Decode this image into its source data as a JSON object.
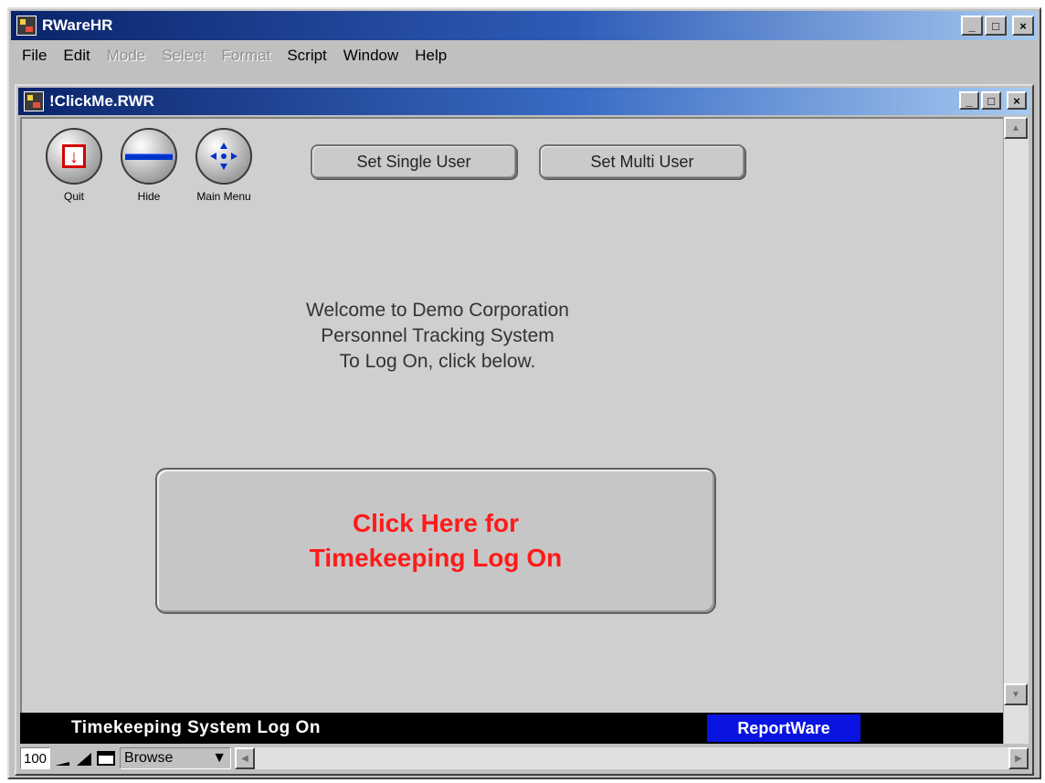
{
  "app": {
    "title": "RWareHR",
    "window_buttons": {
      "minimize": "_",
      "maximize": "□",
      "close": "×"
    }
  },
  "menubar": {
    "items": [
      {
        "label": "File",
        "enabled": true
      },
      {
        "label": "Edit",
        "enabled": true
      },
      {
        "label": "Mode",
        "enabled": false
      },
      {
        "label": "Select",
        "enabled": false
      },
      {
        "label": "Format",
        "enabled": false
      },
      {
        "label": "Script",
        "enabled": true
      },
      {
        "label": "Window",
        "enabled": true
      },
      {
        "label": "Help",
        "enabled": true
      }
    ]
  },
  "document": {
    "title": "!ClickMe.RWR"
  },
  "toolbar": {
    "quit_label": "Quit",
    "hide_label": "Hide",
    "main_menu_label": "Main Menu",
    "set_single_user_label": "Set Single User",
    "set_multi_user_label": "Set Multi User"
  },
  "welcome": {
    "line1": "Welcome to Demo Corporation",
    "line2": "Personnel Tracking System",
    "line3": "To Log On, click below."
  },
  "logon_button": {
    "line1": "Click Here for",
    "line2": "Timekeeping Log On"
  },
  "statusbar": {
    "text": "Timekeeping System Log On",
    "brand": "ReportWare"
  },
  "bottombar": {
    "zoom": "100",
    "mode": "Browse"
  },
  "colors": {
    "accent_red": "#ff1a1a",
    "brand_blue": "#0a14e0",
    "hide_bar_blue": "#0033cc",
    "titlebar_blue": "#0a246a"
  },
  "icons": [
    "app-icon",
    "quit-icon",
    "hide-icon",
    "main-menu-icon"
  ]
}
